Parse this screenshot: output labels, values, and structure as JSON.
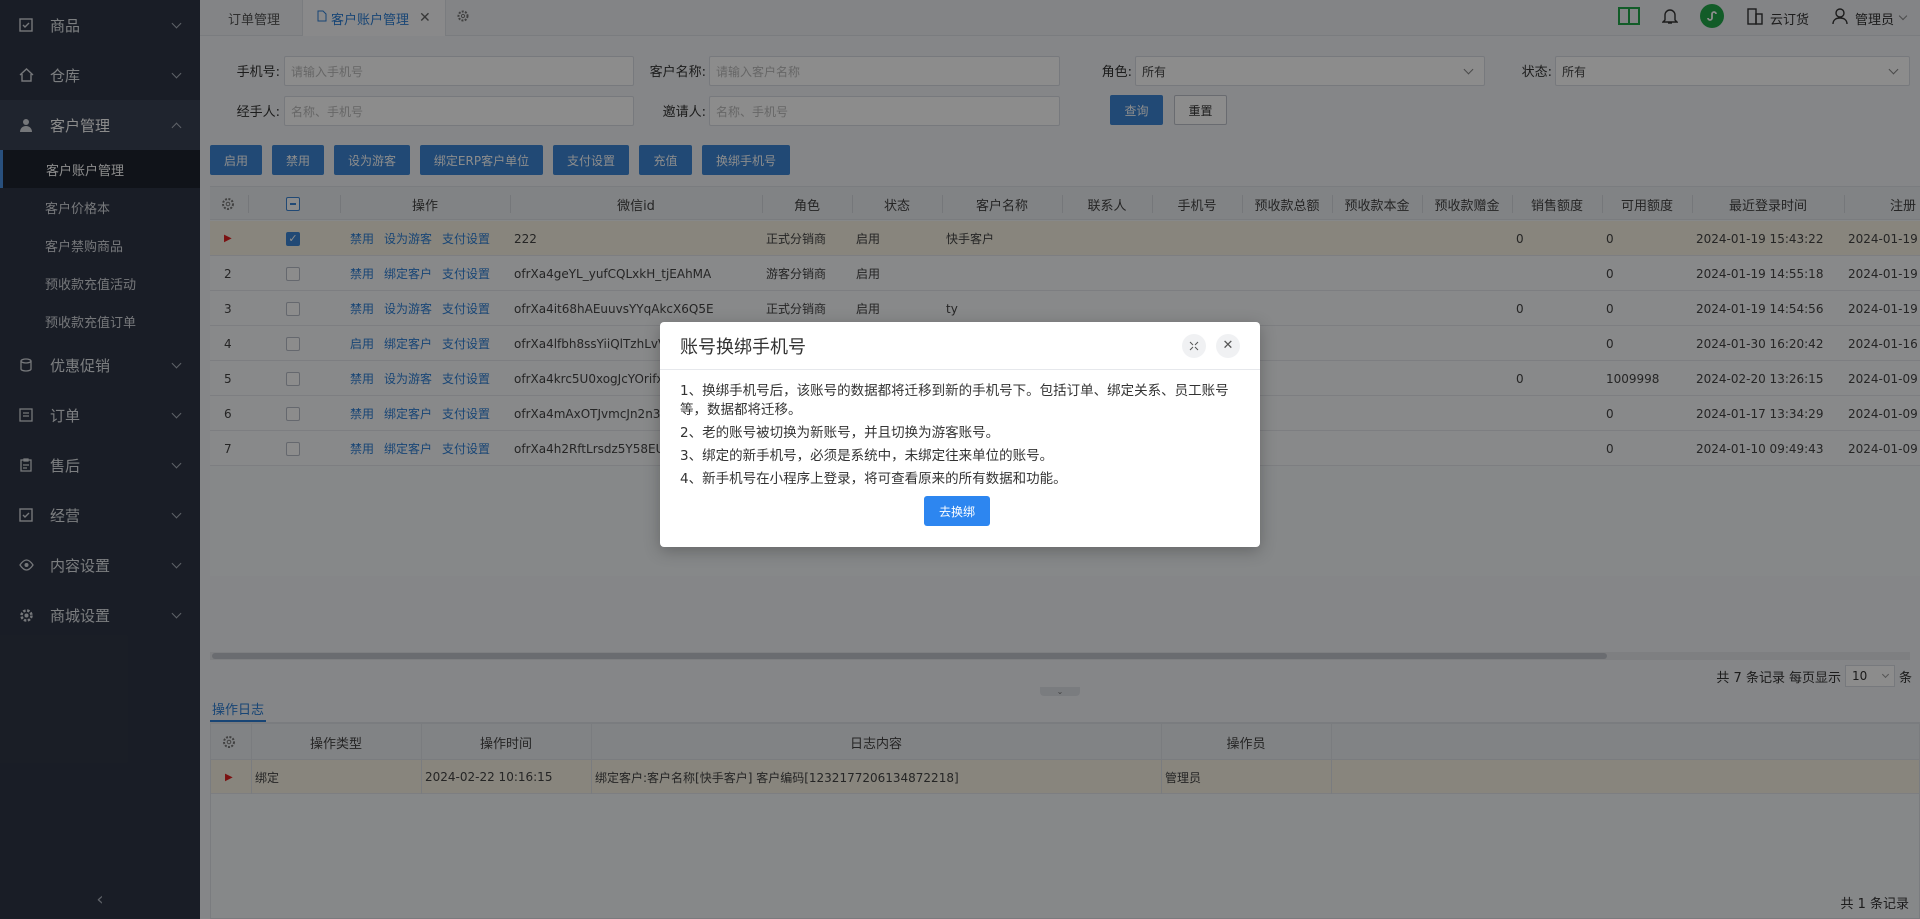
{
  "sidebar": {
    "groups": [
      {
        "label": "商品",
        "icon": "checkbox-icon"
      },
      {
        "label": "仓库",
        "icon": "home-icon"
      },
      {
        "label": "客户管理",
        "icon": "user-icon"
      },
      {
        "label": "优惠促销",
        "icon": "database-icon"
      },
      {
        "label": "订单",
        "icon": "list-icon"
      },
      {
        "label": "售后",
        "icon": "clipboard-icon"
      },
      {
        "label": "经营",
        "icon": "checkbox-icon"
      },
      {
        "label": "内容设置",
        "icon": "eye-icon"
      },
      {
        "label": "商城设置",
        "icon": "gear-icon"
      }
    ],
    "sub_items": [
      "客户账户管理",
      "客户价格本",
      "客户禁购商品",
      "预收款充值活动",
      "预收款充值订单"
    ]
  },
  "tabs": [
    {
      "label": "订单管理"
    },
    {
      "label": "客户账户管理"
    }
  ],
  "topbar": {
    "store_label": "云订货",
    "user_label": "管理员"
  },
  "filters": {
    "phone_label": "手机号:",
    "phone_placeholder": "请输入手机号",
    "customer_label": "客户名称:",
    "customer_placeholder": "请输入客户名称",
    "role_label": "角色:",
    "role_value": "所有",
    "status_label": "状态:",
    "status_value": "所有",
    "handler_label": "经手人:",
    "handler_placeholder": "名称、手机号",
    "inviter_label": "邀请人:",
    "inviter_placeholder": "名称、手机号",
    "query_btn": "查询",
    "reset_btn": "重置"
  },
  "toolbar": [
    "启用",
    "禁用",
    "设为游客",
    "绑定ERP客户单位",
    "支付设置",
    "充值",
    "换绑手机号"
  ],
  "table": {
    "headers": [
      "操作",
      "微信id",
      "角色",
      "状态",
      "客户名称",
      "联系人",
      "手机号",
      "预收款总额",
      "预收款本金",
      "预收款赠金",
      "销售额度",
      "可用额度",
      "最近登录时间",
      "注册"
    ],
    "rows": [
      {
        "no": "",
        "actions": [
          "禁用",
          "设为游客",
          "支付设置"
        ],
        "wechat": "222",
        "role": "正式分销商",
        "status": "启用",
        "customer": "快手客户",
        "sales": "0",
        "avail": "0",
        "login": "2024-01-19 15:43:22",
        "reg": "2024-01-19"
      },
      {
        "no": "2",
        "actions": [
          "禁用",
          "绑定客户",
          "支付设置"
        ],
        "wechat": "ofrXa4geYL_yufCQLxkH_tjEAhMA",
        "role": "游客分销商",
        "status": "启用",
        "customer": "",
        "sales": "",
        "avail": "0",
        "login": "2024-01-19 14:55:18",
        "reg": "2024-01-19"
      },
      {
        "no": "3",
        "actions": [
          "禁用",
          "设为游客",
          "支付设置"
        ],
        "wechat": "ofrXa4it68hAEuuvsYYqAkcX6Q5E",
        "role": "正式分销商",
        "status": "启用",
        "customer": "ty",
        "sales": "0",
        "avail": "0",
        "login": "2024-01-19 14:54:56",
        "reg": "2024-01-19"
      },
      {
        "no": "4",
        "actions": [
          "启用",
          "绑定客户",
          "支付设置"
        ],
        "wechat": "ofrXa4lfbh8ssYiiQlTzhLvVjC",
        "role": "",
        "status": "",
        "customer": "",
        "sales": "",
        "avail": "0",
        "login": "2024-01-30 16:20:42",
        "reg": "2024-01-16"
      },
      {
        "no": "5",
        "actions": [
          "禁用",
          "设为游客",
          "支付设置"
        ],
        "wechat": "ofrXa4krc5U0xogJcYOrifxyN",
        "role": "",
        "status": "",
        "customer": "",
        "sales": "0",
        "avail": "1009998",
        "login": "2024-02-20 13:26:15",
        "reg": "2024-01-09"
      },
      {
        "no": "6",
        "actions": [
          "禁用",
          "绑定客户",
          "支付设置"
        ],
        "wechat": "ofrXa4mAxOTJvmcJn2n3x1",
        "role": "",
        "status": "",
        "customer": "",
        "sales": "",
        "avail": "0",
        "login": "2024-01-17 13:34:29",
        "reg": "2024-01-09"
      },
      {
        "no": "7",
        "actions": [
          "禁用",
          "绑定客户",
          "支付设置"
        ],
        "wechat": "ofrXa4h2RftLrsdz5Y58EUxK",
        "role": "",
        "status": "",
        "customer": "",
        "sales": "",
        "avail": "0",
        "login": "2024-01-10 09:49:43",
        "reg": "2024-01-09"
      }
    ]
  },
  "pager": {
    "total": "共 7 条记录",
    "per_page_label": "每页显示",
    "per_page": "10",
    "unit": "条"
  },
  "log": {
    "tab": "操作日志",
    "headers": [
      "操作类型",
      "操作时间",
      "日志内容",
      "操作员"
    ],
    "row": {
      "type": "绑定",
      "time": "2024-02-22 10:16:15",
      "content": "绑定客户:客户名称[快手客户] 客户编码[1232177206134872218]",
      "operator": "管理员"
    },
    "total": "共 1 条记录"
  },
  "modal": {
    "title": "账号换绑手机号",
    "lines": [
      "1、换绑手机号后，该账号的数据都将迁移到新的手机号下。包括订单、绑定关系、员工账号等，数据都将迁移。",
      "2、老的账号被切换为新账号，并且切换为游客账号。",
      "3、绑定的新手机号，必须是系统中，未绑定往来单位的账号。",
      "4、新手机号在小程序上登录，将可查看原来的所有数据和功能。"
    ],
    "confirm": "去换绑"
  }
}
